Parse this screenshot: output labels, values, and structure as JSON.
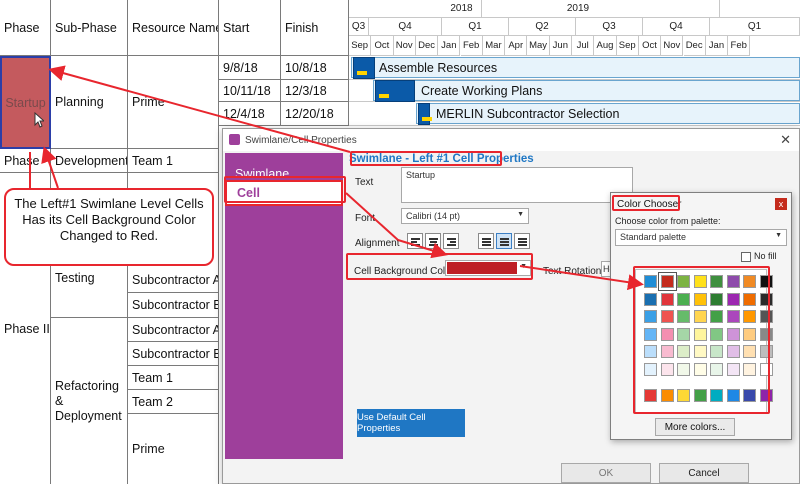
{
  "table": {
    "headers": [
      "Phase",
      "Sub-Phase",
      "Resource Names",
      "Start",
      "Finish"
    ],
    "phases": [
      "Startup",
      "Phase",
      "Phase III"
    ],
    "subphases": [
      "Planning",
      "Development",
      "Testing",
      "Refactoring & Deployment"
    ],
    "resources": [
      "Prime",
      "Team 1",
      "Subcontractor A",
      "Subcontractor B",
      "Subcontractor A",
      "Subcontractor B",
      "Team 1",
      "Team 2",
      "Prime"
    ],
    "starts": [
      "9/8/18",
      "10/11/18",
      "12/4/18"
    ],
    "finishes": [
      "10/8/18",
      "12/3/18",
      "12/20/18"
    ]
  },
  "gantt": {
    "years": [
      "2018",
      "2019"
    ],
    "quarters": [
      "Q3",
      "Q4",
      "Q1",
      "Q2",
      "Q3",
      "Q4",
      "Q1"
    ],
    "months": [
      "Sep",
      "Oct",
      "Nov",
      "Dec",
      "Jan",
      "Feb",
      "Mar",
      "Apr",
      "May",
      "Jun",
      "Jul",
      "Aug",
      "Sep",
      "Oct",
      "Nov",
      "Dec",
      "Jan",
      "Feb"
    ],
    "tasks": [
      "Assemble Resources",
      "Create Working Plans",
      "MERLIN Subcontractor Selection"
    ]
  },
  "dialog": {
    "title": "Swimlane/Cell Properties",
    "close": "✕",
    "sidebar": [
      "Swimlane",
      "Cell"
    ],
    "heading": "Swimlane - Left #1 Cell Properties",
    "text_label": "Text",
    "text_value": "Startup",
    "font_label": "Font",
    "font_value": "Calibri (14 pt)",
    "alignment_label": "Alignment",
    "bg_label": "Cell Background Color",
    "bg_color": "#be1e24",
    "rotation_label": "Text Rotation",
    "rotation_value": "Ho",
    "default_button": "Use Default Cell Properties",
    "ok": "OK",
    "cancel": "Cancel"
  },
  "chooser": {
    "title": "Color Chooser",
    "close": "x",
    "prompt": "Choose color from palette:",
    "palette": "Standard palette",
    "nofill": "No fill",
    "more": "More colors..."
  },
  "callout": {
    "text": "The Left#1 Swimlane Level Cells Has its Cell Background Color Changed to Red."
  },
  "colors": {
    "accent_red": "#e8262e",
    "sidebar_purple": "#9e3f9b",
    "startup_cell": "#c45a5e",
    "button_blue": "#1f77c4"
  }
}
